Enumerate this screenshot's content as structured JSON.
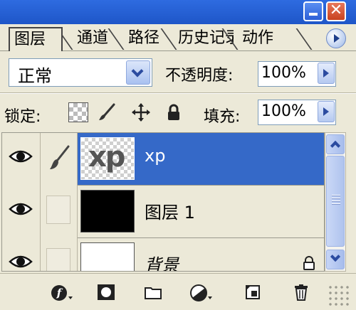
{
  "window": {
    "controls": [
      {
        "name": "minimize-button",
        "icon": "minimize-icon"
      },
      {
        "name": "close-button",
        "icon": "close-icon",
        "glyph": "✕"
      }
    ]
  },
  "tabs": [
    {
      "label": "图层",
      "active": true
    },
    {
      "label": "通道",
      "active": false
    },
    {
      "label": "路径",
      "active": false
    },
    {
      "label": "历史记录",
      "active": false
    },
    {
      "label": "动作",
      "active": false
    }
  ],
  "blend": {
    "mode": "正常",
    "opacity_label": "不透明度:",
    "opacity_value": "100%"
  },
  "lock": {
    "label": "锁定:",
    "icons": [
      "lock-transparent-icon",
      "lock-paint-brush-icon",
      "lock-move-icon",
      "lock-all-padlock-icon"
    ],
    "fill_label": "填充:",
    "fill_value": "100%"
  },
  "layers": [
    {
      "name": "xp",
      "visible": true,
      "selected": true,
      "thumb_text": "xp",
      "link_icon": "brush-icon"
    },
    {
      "name": "图层 1",
      "visible": true,
      "selected": false
    },
    {
      "name": "背景",
      "visible": true,
      "selected": false,
      "locked": true
    }
  ],
  "bottom_toolbar": [
    "layer-style-icon",
    "layer-mask-icon",
    "layer-set-folder-icon",
    "adjustment-layer-icon",
    "new-layer-icon",
    "delete-layer-trash-icon"
  ],
  "colors": {
    "panel_bg": "#ECE9D8",
    "selection": "#3569C8",
    "titlebar": "#1E56C8",
    "close": "#C8421F"
  }
}
